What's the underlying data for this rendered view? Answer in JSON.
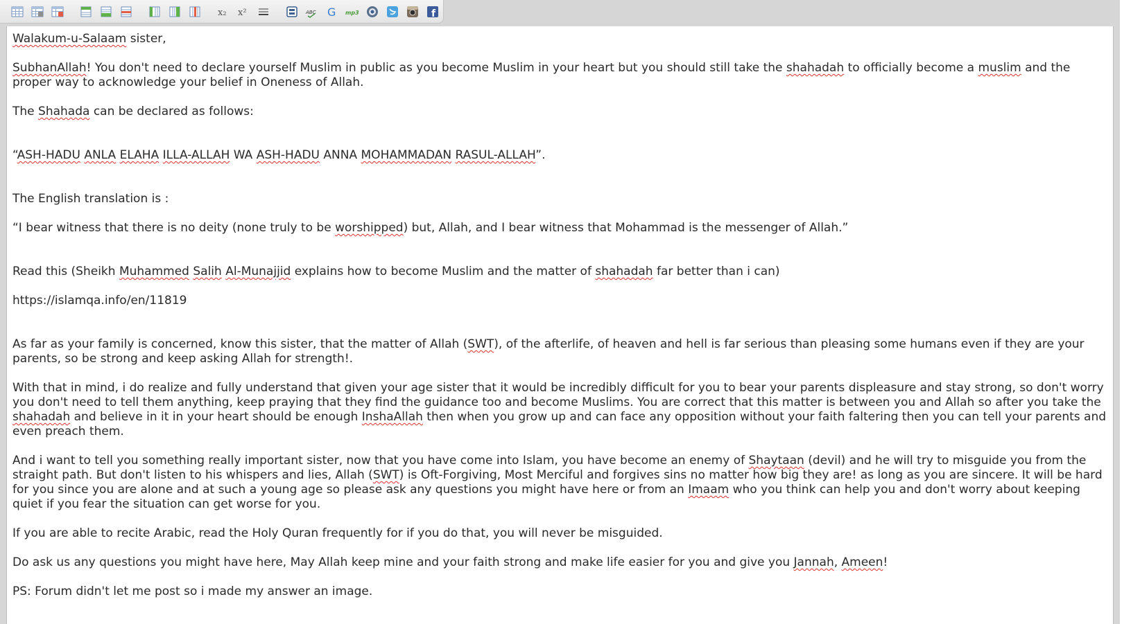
{
  "toolbar": {
    "icons": [
      "table-icon",
      "table-properties-icon",
      "delete-table-icon",
      "insert-row-above-icon",
      "insert-row-below-icon",
      "delete-row-icon",
      "insert-column-before-icon",
      "insert-column-after-icon",
      "delete-column-icon",
      "subscript-icon",
      "superscript-icon",
      "horizontal-rule-icon",
      "media-icon",
      "spellcheck-icon",
      "google-icon",
      "mp3-icon",
      "record-icon",
      "twitter-icon",
      "instagram-icon",
      "facebook-icon"
    ],
    "subscript_glyph": "x₂",
    "superscript_glyph": "x²",
    "spellcheck_glyph": "ABC",
    "mp3_glyph": "mp3",
    "google_glyph": "G",
    "facebook_glyph": "f"
  },
  "colors": {
    "frame": "#d6d6d6",
    "toolbar": "#eeeeee",
    "text": "#2a2a2a",
    "spell_underline": "#e0302a"
  },
  "editor": {
    "paragraphs": [
      {
        "gap": 1,
        "parts": [
          {
            "t": "Walakum-u-Salaam",
            "sp": true
          },
          {
            "t": " sister,"
          }
        ]
      },
      {
        "gap": 1,
        "parts": [
          {
            "t": "SubhanAllah",
            "sp": true
          },
          {
            "t": "! You don't need to declare yourself Muslim in public as you become Muslim in your heart but you should still take the "
          },
          {
            "t": "shahadah",
            "sp": true
          },
          {
            "t": " to officially become a "
          },
          {
            "t": "muslim",
            "sp": true
          },
          {
            "t": " and the proper way to acknowledge your belief in Oneness of Allah."
          }
        ]
      },
      {
        "gap": 2,
        "parts": [
          {
            "t": "The "
          },
          {
            "t": "Shahada",
            "sp": true
          },
          {
            "t": " can be declared as follows:"
          }
        ]
      },
      {
        "gap": 2,
        "parts": [
          {
            "t": "“"
          },
          {
            "t": "ASH-HADU",
            "sp": true
          },
          {
            "t": " "
          },
          {
            "t": "ANLA",
            "sp": true
          },
          {
            "t": " "
          },
          {
            "t": "ELAHA",
            "sp": true
          },
          {
            "t": " "
          },
          {
            "t": "ILLA-ALLAH",
            "sp": true
          },
          {
            "t": " WA "
          },
          {
            "t": "ASH-HADU",
            "sp": true
          },
          {
            "t": " ANNA "
          },
          {
            "t": "MOHAMMADAN",
            "sp": true
          },
          {
            "t": " "
          },
          {
            "t": "RASUL-ALLAH",
            "sp": true
          },
          {
            "t": "”."
          }
        ]
      },
      {
        "gap": 1,
        "parts": [
          {
            "t": "The English translation is :"
          }
        ]
      },
      {
        "gap": 2,
        "parts": [
          {
            "t": "“I bear witness that there is no deity (none truly to be "
          },
          {
            "t": "worshipped",
            "sp": true
          },
          {
            "t": ") but, Allah, and I bear witness that Mohammad is the messenger of Allah.”"
          }
        ]
      },
      {
        "gap": 1,
        "parts": [
          {
            "t": "Read this (Sheikh "
          },
          {
            "t": "Muhammed",
            "sp": true
          },
          {
            "t": " "
          },
          {
            "t": "Salih",
            "sp": true
          },
          {
            "t": " "
          },
          {
            "t": "Al-Munajjid",
            "sp": true
          },
          {
            "t": " explains how to become Muslim and the matter of "
          },
          {
            "t": "shahadah",
            "sp": true
          },
          {
            "t": " far better than i can)"
          }
        ]
      },
      {
        "gap": 2,
        "parts": [
          {
            "t": "https://islamqa.info/en/11819"
          }
        ]
      },
      {
        "gap": 1,
        "parts": [
          {
            "t": "As far as your family is concerned, know this sister, that the matter of Allah ("
          },
          {
            "t": "SWT",
            "sp": true
          },
          {
            "t": "), of the afterlife, of heaven and hell is far serious than pleasing some humans even if they are your parents, so be strong and keep asking Allah for strength!."
          }
        ]
      },
      {
        "gap": 1,
        "parts": [
          {
            "t": "With that in mind, i do realize and fully understand that given your age sister that it would be incredibly difficult for you to bear your parents displeasure and stay strong, so don't worry you don't need to tell them anything, keep praying that they find the guidance too and become Muslims. You are correct that this matter is between you and Allah so after you take the "
          },
          {
            "t": "shahadah",
            "sp": true
          },
          {
            "t": " and believe in it in your heart should be enough "
          },
          {
            "t": "InshaAllah",
            "sp": true
          },
          {
            "t": " then when you grow up and can face any opposition without your faith faltering then you can tell your parents and even preach them."
          }
        ]
      },
      {
        "gap": 1,
        "parts": [
          {
            "t": "And i want to tell you something really important sister, now that you have come into Islam, you have become an enemy of "
          },
          {
            "t": "Shaytaan",
            "sp": true
          },
          {
            "t": " (devil) and he will try to misguide you from the straight path. But don't listen to his whispers and lies, Allah ("
          },
          {
            "t": "SWT",
            "sp": true
          },
          {
            "t": ") is Oft-Forgiving, Most Merciful and forgives sins no matter how big they are! as long as you are sincere. It will be hard for you since you are alone and at such a young age so please ask any questions you might have here or from an "
          },
          {
            "t": "Imaam",
            "sp": true
          },
          {
            "t": " who you think can help you and don't worry about keeping quiet if you fear the situation can get worse for you."
          }
        ]
      },
      {
        "gap": 1,
        "parts": [
          {
            "t": "If you are able to recite Arabic, read the Holy Quran frequently for if you do that, you will never be misguided."
          }
        ]
      },
      {
        "gap": 1,
        "parts": [
          {
            "t": "Do ask us any questions you might have here, May Allah keep mine and your faith strong and make life easier for you and give you "
          },
          {
            "t": "Jannah",
            "sp": true
          },
          {
            "t": ", "
          },
          {
            "t": "Ameen",
            "sp": true
          },
          {
            "t": "!"
          }
        ]
      },
      {
        "gap": 1,
        "parts": [
          {
            "t": "PS: Forum didn't let me post so i made my answer an image."
          }
        ]
      }
    ]
  }
}
